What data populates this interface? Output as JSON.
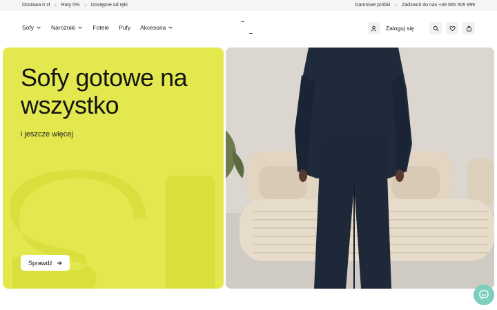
{
  "topbar": {
    "left": [
      "Dostawa 0 zł",
      "Raty 0%",
      "Dostępne od ręki"
    ],
    "right": [
      "Darmowe próbki",
      "Zadzwoń do nas +48 665 505 999"
    ]
  },
  "nav": {
    "items": [
      {
        "label": "Sofy",
        "dropdown": true
      },
      {
        "label": "Narożniki",
        "dropdown": true
      },
      {
        "label": "Fotele",
        "dropdown": false
      },
      {
        "label": "Pufy",
        "dropdown": false
      },
      {
        "label": "Akcesoria",
        "dropdown": true
      }
    ]
  },
  "header": {
    "login_label": "Zaloguj się",
    "icons": [
      "user-icon",
      "search-icon",
      "heart-icon",
      "bag-icon"
    ]
  },
  "hero": {
    "title": "Sofy gotowe na wszystko",
    "subtitle": "i jeszcze więcej",
    "cta_label": "Sprawdź",
    "panel_color": "#e3e84f"
  },
  "chat": {
    "color": "#7ccfbd",
    "icon": "chat-icon"
  }
}
